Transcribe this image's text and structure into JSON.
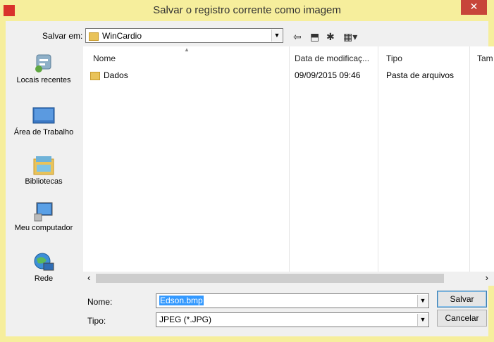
{
  "window": {
    "title": "Salvar o registro corrente como imagem",
    "close_glyph": "✕"
  },
  "toolbar": {
    "save_in_label": "Salvar em:",
    "save_in_value": "WinCardio",
    "back_glyph": "⇦",
    "up_glyph": "⬒",
    "newfolder_glyph": "✱",
    "view_glyph": "▦▾"
  },
  "places": [
    {
      "label": "Locais recentes",
      "icon": "recent-places-icon"
    },
    {
      "label": "Área de Trabalho",
      "icon": "desktop-icon"
    },
    {
      "label": "Bibliotecas",
      "icon": "libraries-icon"
    },
    {
      "label": "Meu computador",
      "icon": "computer-icon"
    },
    {
      "label": "Rede",
      "icon": "network-icon"
    }
  ],
  "columns": [
    "Nome",
    "Data de modificaç...",
    "Tipo",
    "Tam"
  ],
  "files": [
    {
      "name": "Dados",
      "modified": "09/09/2015 09:46",
      "type": "Pasta de arquivos"
    }
  ],
  "filename": {
    "label": "Nome:",
    "value": "Edson.bmp"
  },
  "filetype": {
    "label": "Tipo:",
    "value": "JPEG (*.JPG)"
  },
  "buttons": {
    "save": "Salvar",
    "cancel": "Cancelar"
  },
  "colors": {
    "titlebar": "#f6ee9c",
    "close": "#c7453a",
    "selection": "#3399ff"
  }
}
